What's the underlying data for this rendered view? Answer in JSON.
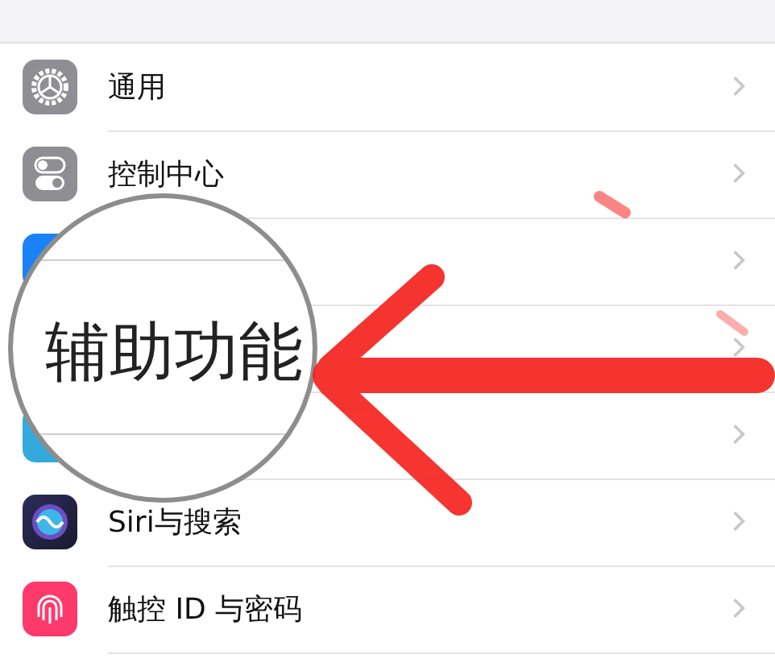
{
  "rows": [
    {
      "kind": "gear",
      "label": "通用"
    },
    {
      "kind": "toggles",
      "label": "控制中心"
    },
    {
      "kind": "blue"
    },
    {
      "kind": "covered"
    },
    {
      "kind": "teal"
    },
    {
      "kind": "siri",
      "label": "Siri与搜索"
    },
    {
      "kind": "fingerprint",
      "label": "触控 ID 与密码"
    }
  ],
  "magnifier": {
    "text": "辅助功能"
  }
}
